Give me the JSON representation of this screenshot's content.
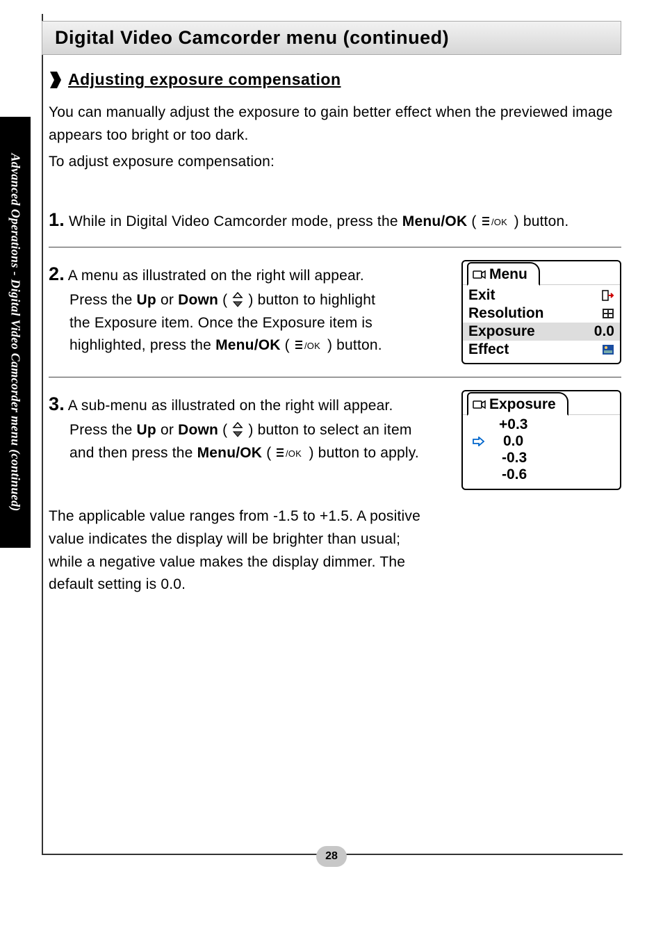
{
  "sidebar": {
    "label": "Advanced Operations - Digital Video Camcorder menu (continued)"
  },
  "title": "Digital Video Camcorder menu (continued)",
  "section_heading": "Adjusting exposure compensation",
  "intro": {
    "p1": "You can manually adjust the exposure to gain better effect when the previewed image appears too bright or too dark.",
    "p2": "To adjust exposure compensation:"
  },
  "step1": {
    "num": "1.",
    "before": " While in Digital Video Camcorder mode, press the ",
    "menu_ok": "Menu/OK",
    "after": " ) button."
  },
  "step2": {
    "num": "2.",
    "line1": " A menu as illustrated on the right will appear.",
    "line2a": "Press the ",
    "up": "Up",
    "or": " or ",
    "down": "Down",
    "line2b": " ) button to highlight",
    "line3": "the Exposure item. Once the Exposure item is",
    "line4a": "highlighted, press the ",
    "menu_ok": "Menu/OK",
    "line4b": " ) button.",
    "menu": {
      "title": "Menu",
      "items": [
        {
          "label": "Exit",
          "icon": "exit"
        },
        {
          "label": "Resolution",
          "icon": "res"
        },
        {
          "label": "Exposure",
          "value": "0.0",
          "highlight": true
        },
        {
          "label": "Effect",
          "icon": "effect"
        }
      ]
    }
  },
  "step3": {
    "num": "3.",
    "line1": " A sub-menu as illustrated on the right will appear.",
    "line2a": "Press the ",
    "up": "Up",
    "or": " or ",
    "down": "Down",
    "line2b": " ) button to select an item",
    "line3a": "and then press the ",
    "menu_ok": "Menu/OK",
    "line3b": " ) button to apply.",
    "submenu": {
      "title": "Exposure",
      "items": [
        {
          "label": "+0.3"
        },
        {
          "label": "0.0",
          "selected": true
        },
        {
          "label": "-0.3"
        },
        {
          "label": "-0.6"
        }
      ]
    }
  },
  "footer_para": "The applicable value ranges from -1.5 to +1.5. A positive value indicates the display will be brighter than usual; while a negative value makes the display dimmer. The default setting is 0.0.",
  "page_number": "28"
}
